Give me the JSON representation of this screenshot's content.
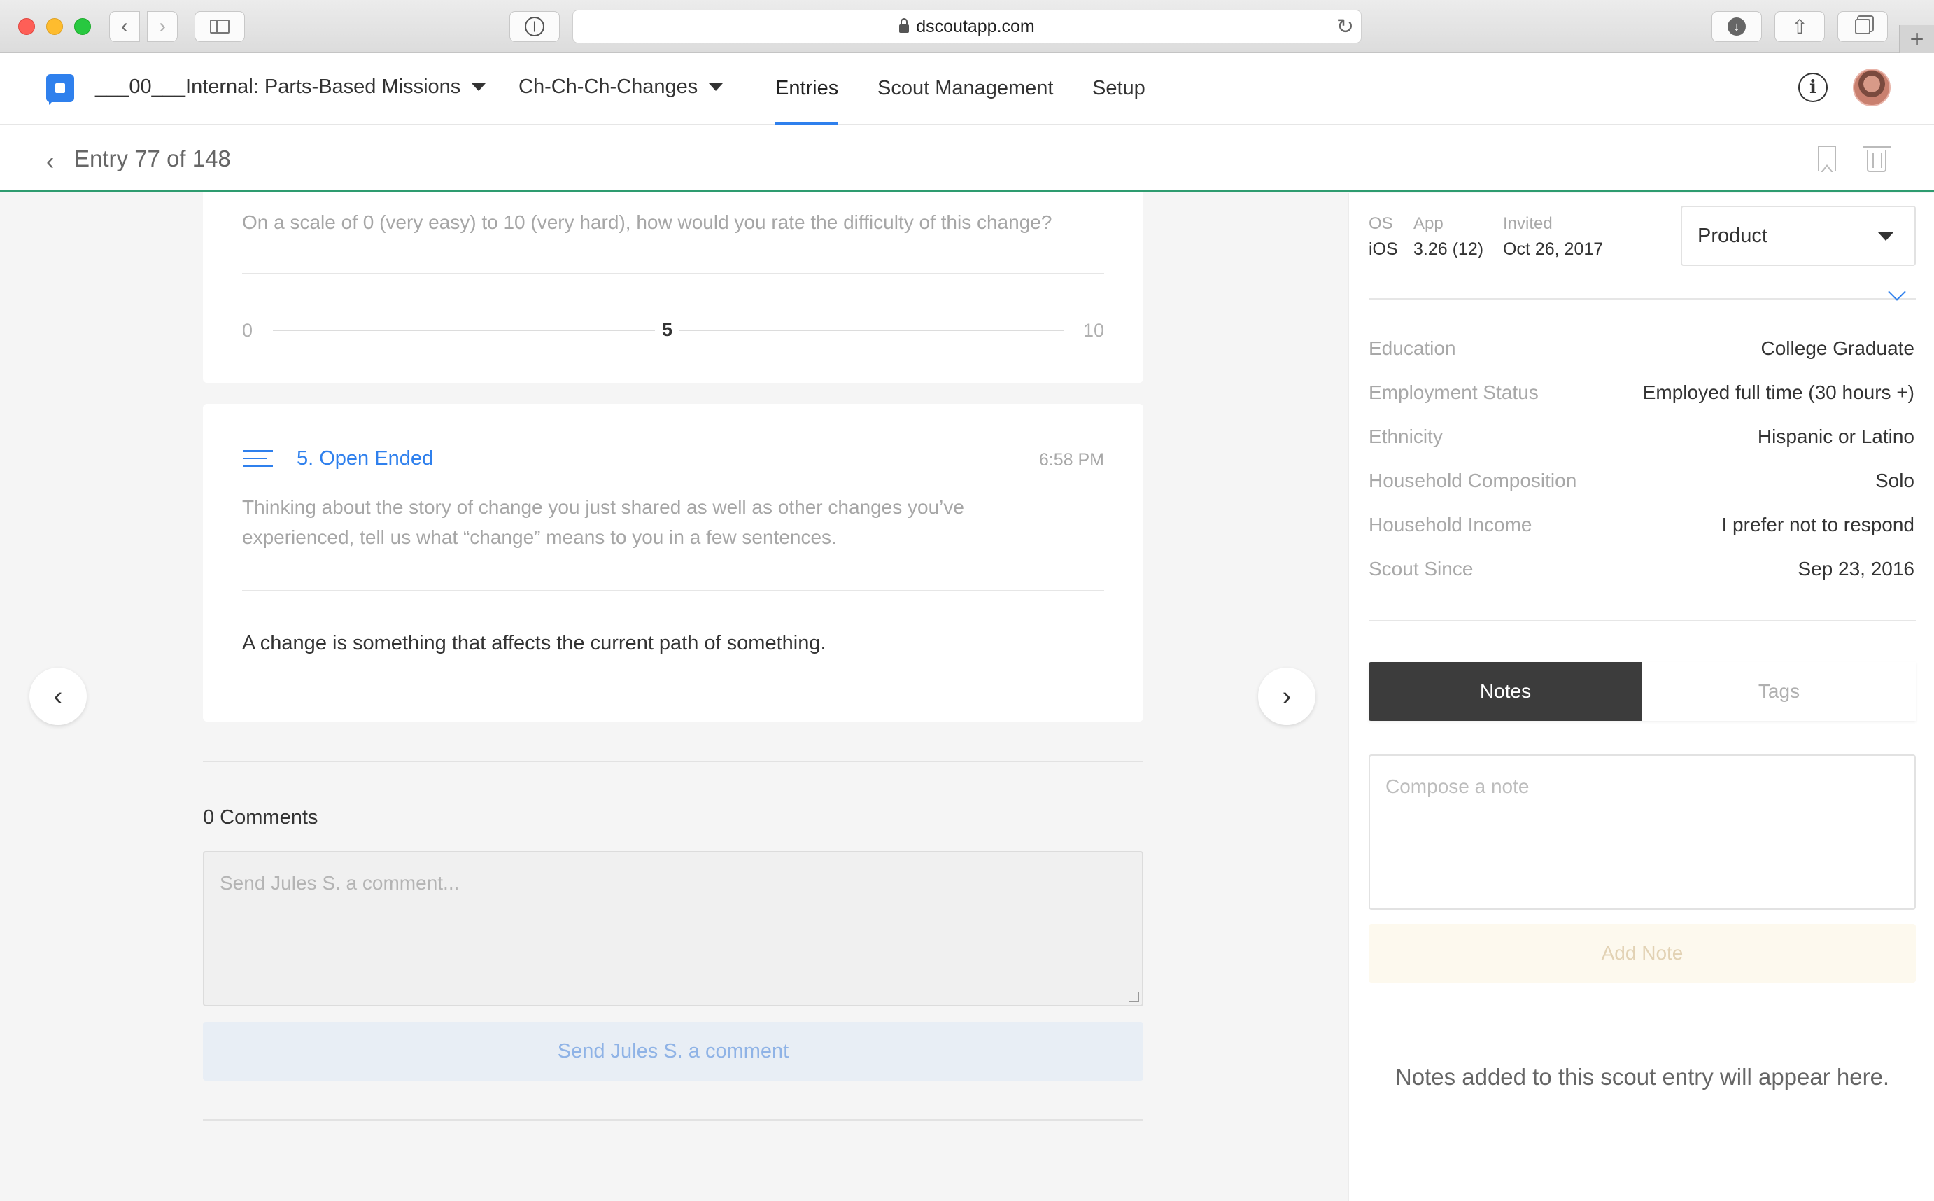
{
  "browser": {
    "url": "dscoutapp.com"
  },
  "header": {
    "project_dropdown": "___00___Internal: Parts-Based Missions",
    "mission_dropdown": "Ch-Ch-Ch-Changes",
    "nav": [
      "Entries",
      "Scout Management",
      "Setup"
    ],
    "active_nav": "Entries"
  },
  "subheader": {
    "title": "Entry 77 of 148"
  },
  "question_scale": {
    "prompt": "On a scale of 0 (very easy) to 10 (very hard), how would you rate the difficulty of this change?",
    "min": "0",
    "max": "10",
    "value": "5"
  },
  "question_open": {
    "title": "5. Open Ended",
    "time": "6:58 PM",
    "prompt": "Thinking about the story of change you just shared as well as other changes you’ve experienced, tell us what “change” means to you in a few sentences.",
    "answer": "A change is something that affects the current path of something."
  },
  "comments": {
    "count_label": "0 Comments",
    "placeholder": "Send Jules S. a comment...",
    "send_label": "Send Jules S. a comment"
  },
  "scout_meta": {
    "os_label": "OS",
    "os_value": "iOS",
    "app_label": "App",
    "app_value": "3.26 (12)",
    "invited_label": "Invited",
    "invited_value": "Oct 26, 2017",
    "select_value": "Product"
  },
  "attributes": [
    {
      "label": "Education",
      "value": "College Graduate"
    },
    {
      "label": "Employment Status",
      "value": "Employed full time (30 hours +)"
    },
    {
      "label": "Ethnicity",
      "value": "Hispanic or Latino"
    },
    {
      "label": "Household Composition",
      "value": "Solo"
    },
    {
      "label": "Household Income",
      "value": "I prefer not to respond"
    },
    {
      "label": "Scout Since",
      "value": "Sep 23, 2016"
    }
  ],
  "notes": {
    "tabs": [
      "Notes",
      "Tags"
    ],
    "active_tab": "Notes",
    "placeholder": "Compose a note",
    "add_label": "Add Note",
    "empty_message": "Notes added to this scout entry will appear here."
  },
  "colors": {
    "accent": "#2f80ed",
    "progress_bar": "#2e9c70",
    "tab_active": "#3c3c3c"
  }
}
